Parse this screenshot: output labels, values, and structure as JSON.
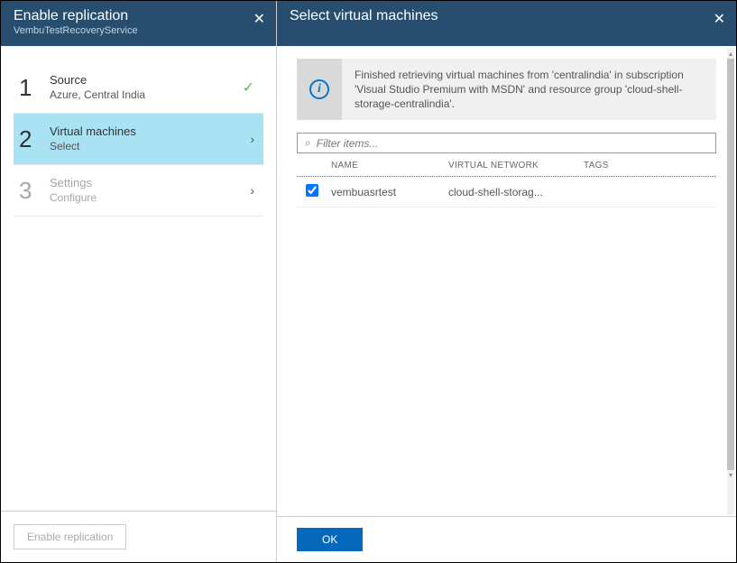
{
  "left": {
    "title": "Enable replication",
    "subtitle": "VembuTestRecoveryService",
    "steps": [
      {
        "num": "1",
        "title": "Source",
        "sub": "Azure, Central India",
        "state": "done"
      },
      {
        "num": "2",
        "title": "Virtual machines",
        "sub": "Select",
        "state": "active"
      },
      {
        "num": "3",
        "title": "Settings",
        "sub": "Configure",
        "state": "disabled"
      }
    ],
    "footer_btn": "Enable replication"
  },
  "right": {
    "title": "Select virtual machines",
    "info_text": "Finished retrieving virtual machines from 'centralindia' in subscription 'Visual Studio Premium with MSDN' and resource group 'cloud-shell-storage-centralindia'.",
    "filter_placeholder": "Filter items...",
    "columns": {
      "name": "NAME",
      "network": "VIRTUAL NETWORK",
      "tags": "TAGS"
    },
    "rows": [
      {
        "checked": true,
        "name": "vembuasrtest",
        "network": "cloud-shell-storag...",
        "tags": ""
      }
    ],
    "ok_label": "OK"
  }
}
